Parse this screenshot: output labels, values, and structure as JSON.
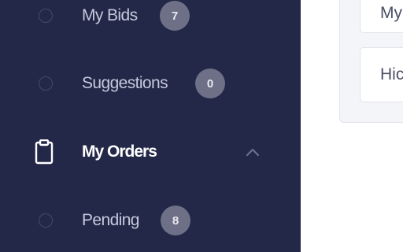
{
  "sidebar": {
    "items": [
      {
        "label": "My Bids",
        "badge": "7",
        "icon": "radio-circle-icon"
      },
      {
        "label": "Suggestions",
        "badge": "0",
        "icon": "radio-circle-icon"
      },
      {
        "label": "My Orders",
        "icon": "clipboard-icon",
        "expanded": true,
        "toggle_icon": "chevron-up-icon"
      },
      {
        "label": "Pending",
        "badge": "8",
        "icon": "radio-circle-icon"
      }
    ]
  },
  "panel": {
    "fields": [
      {
        "text": "My"
      },
      {
        "text": "Hic"
      }
    ]
  },
  "colors": {
    "sidebar_bg": "#232848",
    "badge_bg": "#6d7086",
    "label": "#c5c9dc",
    "active_label": "#ffffff"
  }
}
